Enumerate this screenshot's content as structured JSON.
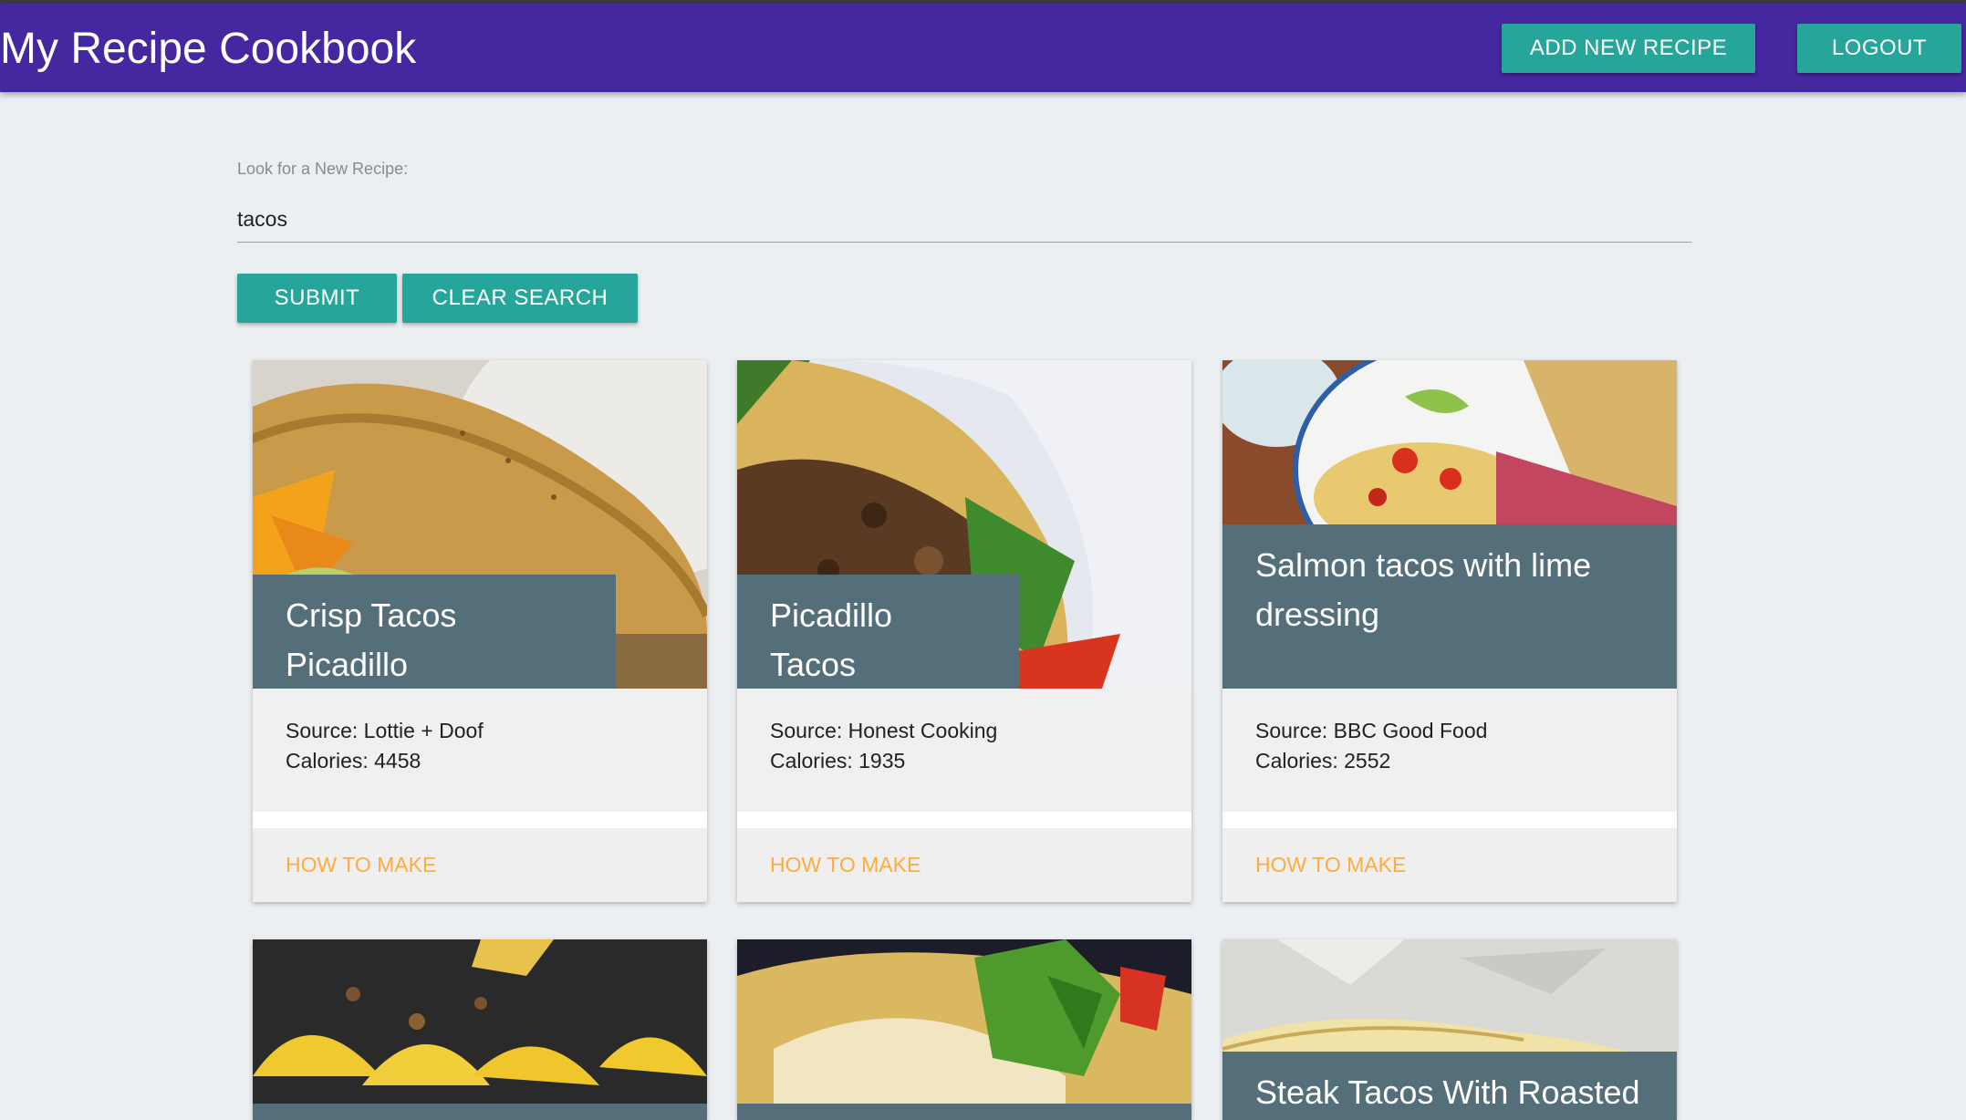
{
  "header": {
    "title": "My Recipe Cookbook",
    "add_button": "ADD NEW RECIPE",
    "logout_button": "LOGOUT"
  },
  "search": {
    "label": "Look for a New Recipe:",
    "value": "tacos",
    "submit_label": "SUBMIT",
    "clear_label": "CLEAR SEARCH"
  },
  "recipes": [
    {
      "title": "Crisp Tacos Picadillo",
      "source": "Source: Lottie + Doof",
      "calories": "Calories: 4458",
      "link": "HOW TO MAKE"
    },
    {
      "title": "Picadillo Tacos",
      "source": "Source: Honest Cooking",
      "calories": "Calories: 1935",
      "link": "HOW TO MAKE"
    },
    {
      "title": "Salmon tacos with lime dressing",
      "source": "Source: BBC Good Food",
      "calories": "Calories: 2552",
      "link": "HOW TO MAKE"
    },
    {
      "title": ""
    },
    {
      "title": ""
    },
    {
      "title": "Steak Tacos With Roasted"
    }
  ],
  "colors": {
    "appbar": "#4527a0",
    "button": "#26a69a",
    "card_title_bg": "#546e7a",
    "link": "#ffab40",
    "background": "#eceff1"
  }
}
